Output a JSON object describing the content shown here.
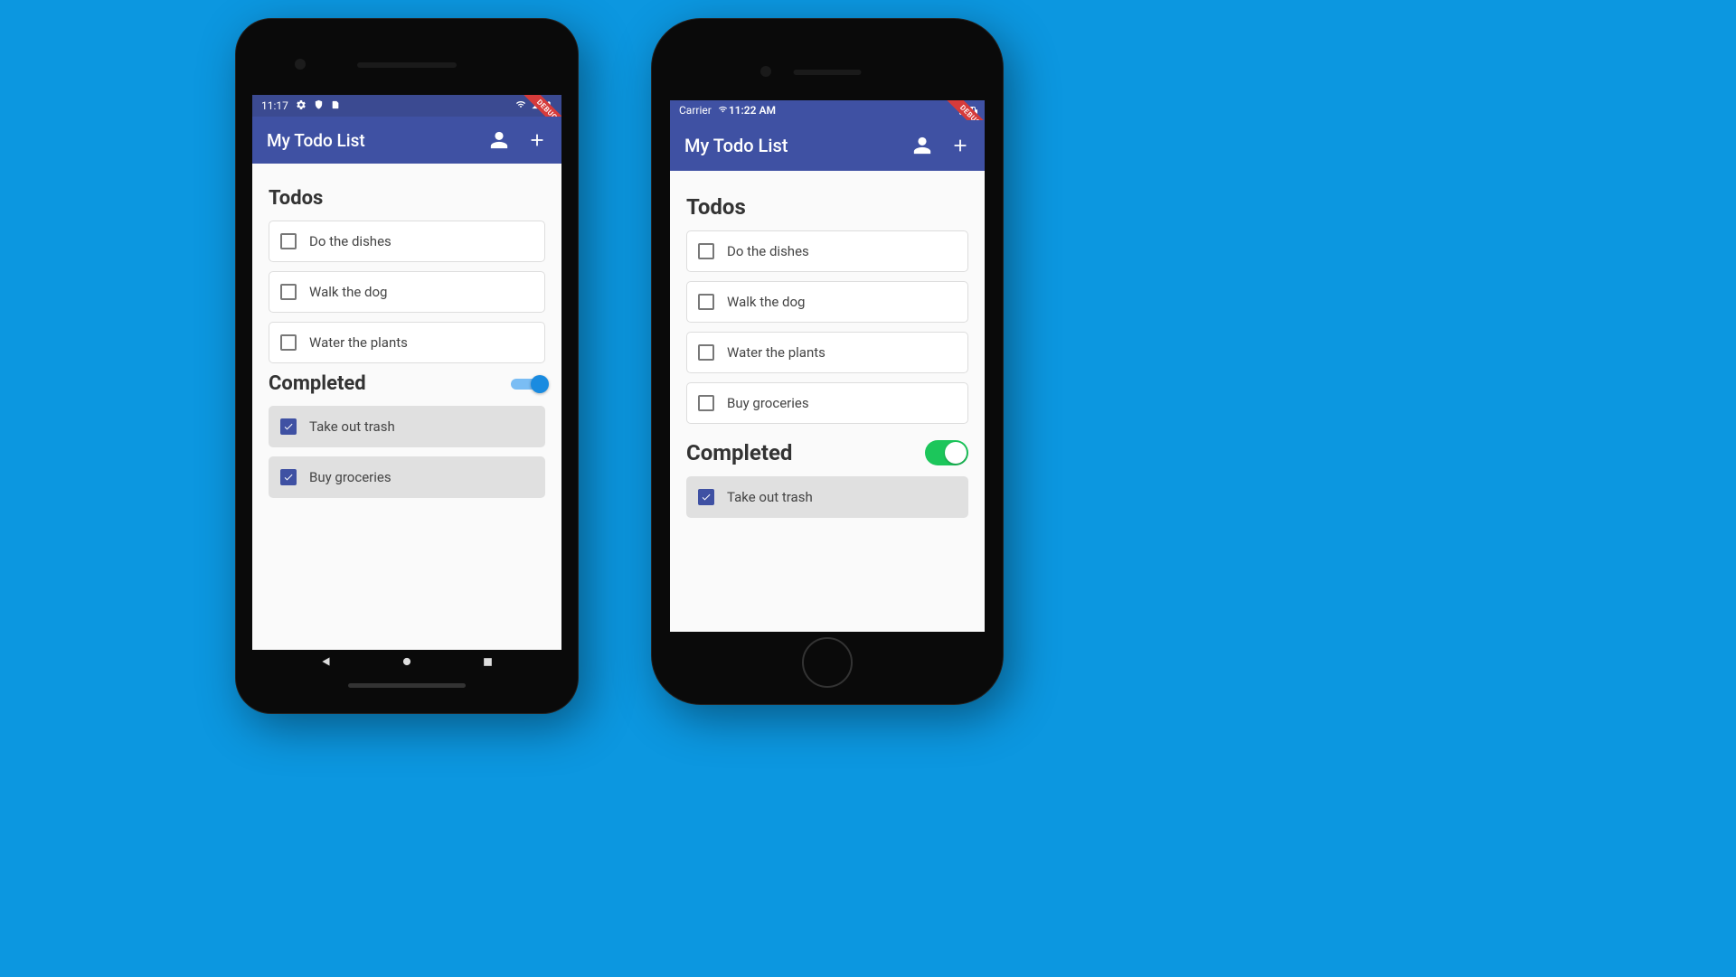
{
  "colors": {
    "appbar": "#3f51a3",
    "accent_android": "#1a8be0",
    "accent_ios": "#1cc65b",
    "debug": "#d63b3b"
  },
  "debug_label": "DEBUG",
  "android": {
    "status": {
      "time": "11:17"
    },
    "app_title": "My Todo List",
    "todos_header": "Todos",
    "completed_header": "Completed",
    "completed_toggle_on": true,
    "todos": [
      {
        "label": "Do the dishes",
        "checked": false
      },
      {
        "label": "Walk the dog",
        "checked": false
      },
      {
        "label": "Water the plants",
        "checked": false
      }
    ],
    "completed": [
      {
        "label": "Take out trash",
        "checked": true
      },
      {
        "label": "Buy groceries",
        "checked": true
      }
    ]
  },
  "ios": {
    "status": {
      "carrier": "Carrier",
      "time": "11:22 AM"
    },
    "app_title": "My Todo List",
    "todos_header": "Todos",
    "completed_header": "Completed",
    "completed_toggle_on": true,
    "todos": [
      {
        "label": "Do the dishes",
        "checked": false
      },
      {
        "label": "Walk the dog",
        "checked": false
      },
      {
        "label": "Water the plants",
        "checked": false
      },
      {
        "label": "Buy groceries",
        "checked": false
      }
    ],
    "completed": [
      {
        "label": "Take out trash",
        "checked": true
      }
    ]
  }
}
